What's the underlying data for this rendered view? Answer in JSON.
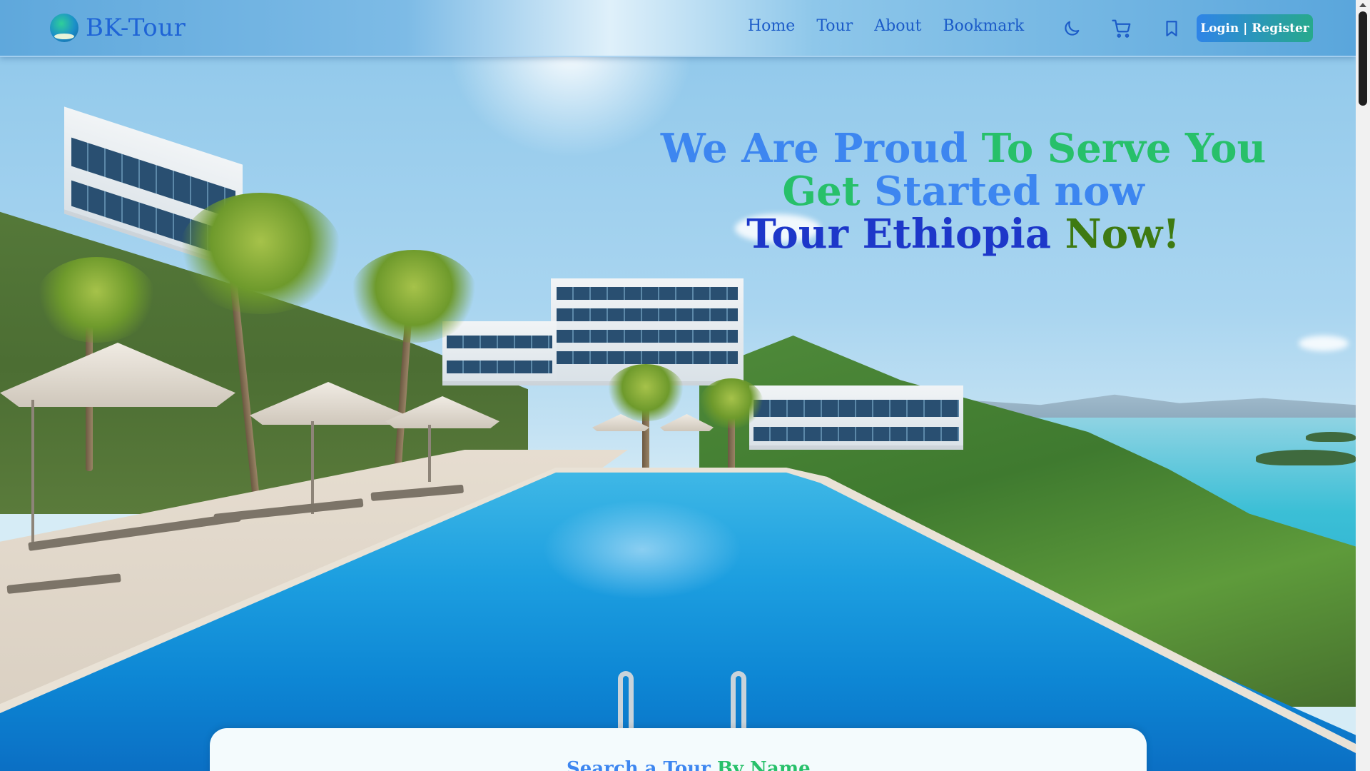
{
  "navbar": {
    "brand": "BK-Tour",
    "links": [
      "Home",
      "Tour",
      "About",
      "Bookmark"
    ],
    "icons": [
      "moon-icon",
      "cart-icon",
      "bookmark-icon"
    ],
    "login_label": "Login | Register",
    "accent_color": "#1f64d6"
  },
  "hero": {
    "line1": {
      "a": "We Are Proud ",
      "b": "To Serve You"
    },
    "line2": {
      "a": "Get ",
      "b": "Started now"
    },
    "line3": {
      "a": "Tour Ethiopia ",
      "b": "Now!"
    },
    "colors": {
      "blue": "#3d86f0",
      "green": "#27c06a",
      "dark_blue": "#1d37c9",
      "olive": "#3e7a12"
    }
  },
  "search": {
    "title_a": "Search a Tour ",
    "title_b": "By Name"
  }
}
